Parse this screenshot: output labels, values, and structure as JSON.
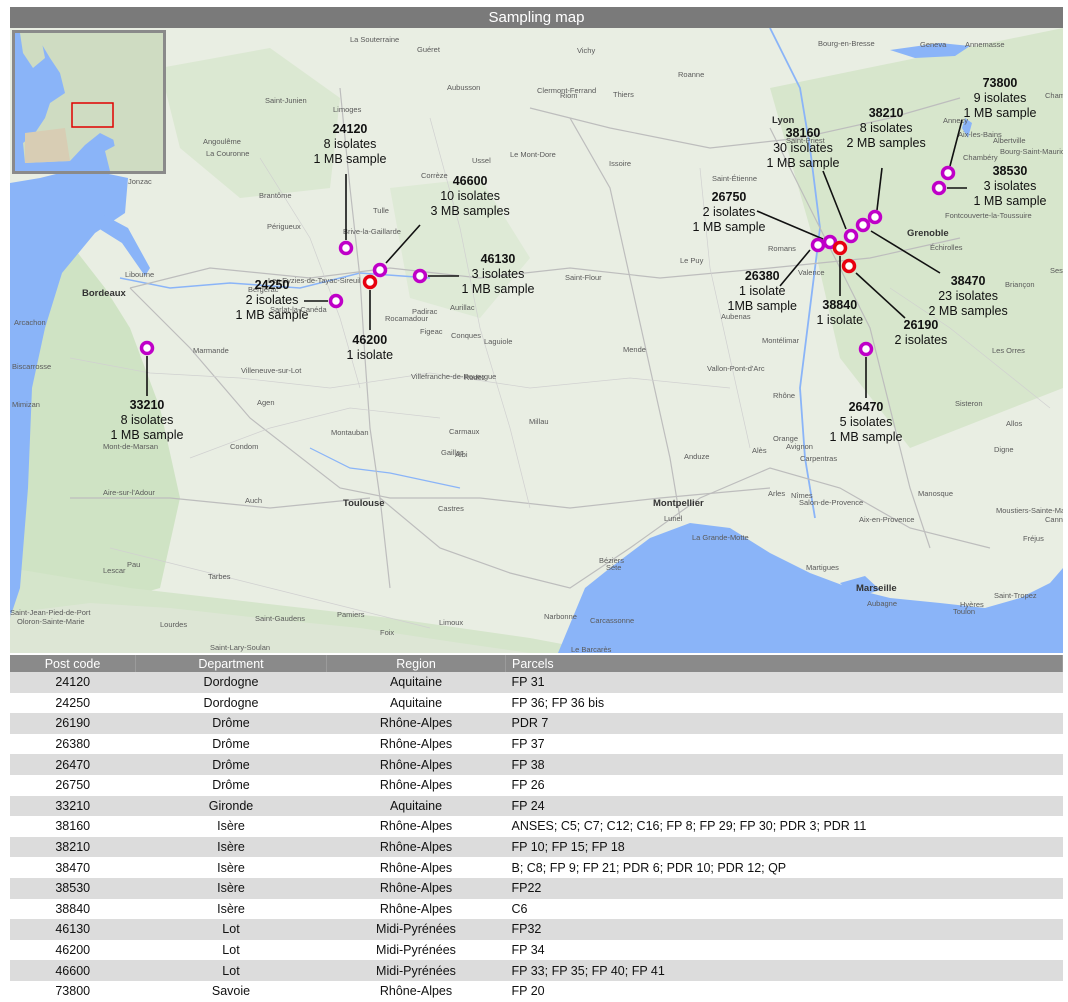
{
  "title": "Sampling map",
  "colors": {
    "marker_purple": "#bf00c8",
    "marker_red": "#e8000f",
    "sea": "#8ab4f8",
    "land": "#e9eee3",
    "header": "#8a8a8a"
  },
  "sites": [
    {
      "post_code": "24120",
      "lines": [
        "8 isolates",
        "1 MB sample"
      ],
      "marker": "purple"
    },
    {
      "post_code": "24250",
      "lines": [
        "2 isolates",
        "1 MB sample"
      ],
      "marker": "purple"
    },
    {
      "post_code": "46600",
      "lines": [
        "10 isolates",
        "3 MB samples"
      ],
      "marker": "purple"
    },
    {
      "post_code": "46130",
      "lines": [
        "3 isolates",
        "1 MB sample"
      ],
      "marker": "purple"
    },
    {
      "post_code": "46200",
      "lines": [
        "1 isolate"
      ],
      "marker": "red"
    },
    {
      "post_code": "33210",
      "lines": [
        "8 isolates",
        "1 MB sample"
      ],
      "marker": "purple"
    },
    {
      "post_code": "38160",
      "lines": [
        "30 isolates",
        "1 MB sample"
      ],
      "marker": "purple"
    },
    {
      "post_code": "38210",
      "lines": [
        "8 isolates",
        "2 MB samples"
      ],
      "marker": "purple"
    },
    {
      "post_code": "73800",
      "lines": [
        "9 isolates",
        "1 MB sample"
      ],
      "marker": "purple"
    },
    {
      "post_code": "38530",
      "lines": [
        "3 isolates",
        "1 MB sample"
      ],
      "marker": "purple"
    },
    {
      "post_code": "26750",
      "lines": [
        "2 isolates",
        "1 MB sample"
      ],
      "marker": "purple"
    },
    {
      "post_code": "26380",
      "lines": [
        "1 isolate",
        "1MB sample"
      ],
      "marker": "purple"
    },
    {
      "post_code": "38840",
      "lines": [
        "1 isolate"
      ],
      "marker": "red"
    },
    {
      "post_code": "38470",
      "lines": [
        "23 isolates",
        "2 MB samples"
      ],
      "marker": "purple"
    },
    {
      "post_code": "26190",
      "lines": [
        "2 isolates"
      ],
      "marker": "red"
    },
    {
      "post_code": "26470",
      "lines": [
        "5 isolates",
        "1 MB sample"
      ],
      "marker": "purple"
    }
  ],
  "places": [
    "La Souterraine",
    "Guéret",
    "Vichy",
    "Bourg-en-Bresse",
    "Geneva",
    "Annemasse",
    "Aubusson",
    "Riom",
    "Roanne",
    "Thiers",
    "Clermont-Ferrand",
    "Saint-Junien",
    "Limoges",
    "Angoulême",
    "La Couronne",
    "Jonzac",
    "Ussel",
    "Le Mont-Dore",
    "Issoire",
    "Lyon",
    "Annecy",
    "Chamonix",
    "Saint-Priest",
    "Aix-les-Bains",
    "Albertville",
    "Chambéry",
    "Bourg-Saint-Maurice",
    "Saint-Étienne",
    "Brantôme",
    "Corrèze",
    "Périgueux",
    "Tulle",
    "Brive-la-Gaillarde",
    "Grenoble",
    "Fontcouverte-la-Toussuire",
    "Libourne",
    "Les Eyzies-de-Tayac-Sireuil",
    "Bordeaux",
    "Bergerac",
    "Sarlat-la-Canéda",
    "Rocamadour",
    "Padirac",
    "Aurillac",
    "Saint-Flour",
    "Le Puy",
    "Romans",
    "Valence",
    "Échirolles",
    "Briançon",
    "Sestriere",
    "Arcachon",
    "Figeac",
    "Conques",
    "Laguiole",
    "Aubenas",
    "Montélimar",
    "Les Orres",
    "Marmande",
    "Villeneuve-sur-Lot",
    "Mende",
    "Biscarrosse",
    "Villefranche-de-Rouergue",
    "Rodez",
    "Vallon-Pont-d'Arc",
    "Mimizan",
    "Agen",
    "Sisteron",
    "Millau",
    "Orange",
    "Carpentras",
    "Alès",
    "Allos",
    "Carmaux",
    "Montauban",
    "Anduze",
    "Mont-de-Marsan",
    "Albi",
    "Gaillac",
    "Condom",
    "Avignon",
    "Digne",
    "Nîmes",
    "Manosque",
    "Moustiers-Sainte-Marie",
    "Aire-sur-l'Adour",
    "Auch",
    "Toulouse",
    "Castres",
    "Montpellier",
    "Arles",
    "Salon-de-Provence",
    "Lunel",
    "La Grande-Motte",
    "Aix-en-Provence",
    "Cannes",
    "Fréjus",
    "Béziers",
    "Sète",
    "Martigues",
    "Marseille",
    "Aubagne",
    "Saint-Tropez",
    "Lescar",
    "Pau",
    "Tarbes",
    "Carcassonne",
    "Narbonne",
    "Toulon",
    "Hyères",
    "Lourdes",
    "Saint-Gaudens",
    "Pamiers",
    "Limoux",
    "Saint-Jean-Pied-de-Port",
    "Oloron-Sainte-Marie",
    "Foix",
    "Saint-Lary-Soulan",
    "Le Barcarès",
    "Rhône"
  ],
  "table": {
    "headers": [
      "Post code",
      "Department",
      "Region",
      "Parcels"
    ],
    "rows": [
      [
        "24120",
        "Dordogne",
        "Aquitaine",
        "FP 31"
      ],
      [
        "24250",
        "Dordogne",
        "Aquitaine",
        "FP 36; FP 36 bis"
      ],
      [
        "26190",
        "Drôme",
        "Rhône-Alpes",
        "PDR 7"
      ],
      [
        "26380",
        "Drôme",
        "Rhône-Alpes",
        "FP 37"
      ],
      [
        "26470",
        "Drôme",
        "Rhône-Alpes",
        "FP 38"
      ],
      [
        "26750",
        "Drôme",
        "Rhône-Alpes",
        "FP 26"
      ],
      [
        "33210",
        "Gironde",
        "Aquitaine",
        "FP 24"
      ],
      [
        "38160",
        "Isère",
        "Rhône-Alpes",
        "ANSES; C5; C7; C12; C16; FP 8; FP 29; FP 30; PDR 3; PDR 11"
      ],
      [
        "38210",
        "Isère",
        "Rhône-Alpes",
        "FP 10; FP 15; FP 18"
      ],
      [
        "38470",
        "Isère",
        "Rhône-Alpes",
        "B; C8; FP 9; FP 21; PDR 6; PDR 10; PDR 12; QP"
      ],
      [
        "38530",
        "Isère",
        "Rhône-Alpes",
        "FP22"
      ],
      [
        "38840",
        "Isère",
        "Rhône-Alpes",
        "C6"
      ],
      [
        "46130",
        "Lot",
        "Midi-Pyrénées",
        "FP32"
      ],
      [
        "46200",
        "Lot",
        "Midi-Pyrénées",
        "FP 34"
      ],
      [
        "46600",
        "Lot",
        "Midi-Pyrénées",
        "FP 33; FP 35; FP 40; FP 41"
      ],
      [
        "73800",
        "Savoie",
        "Rhône-Alpes",
        "FP 20"
      ]
    ]
  }
}
